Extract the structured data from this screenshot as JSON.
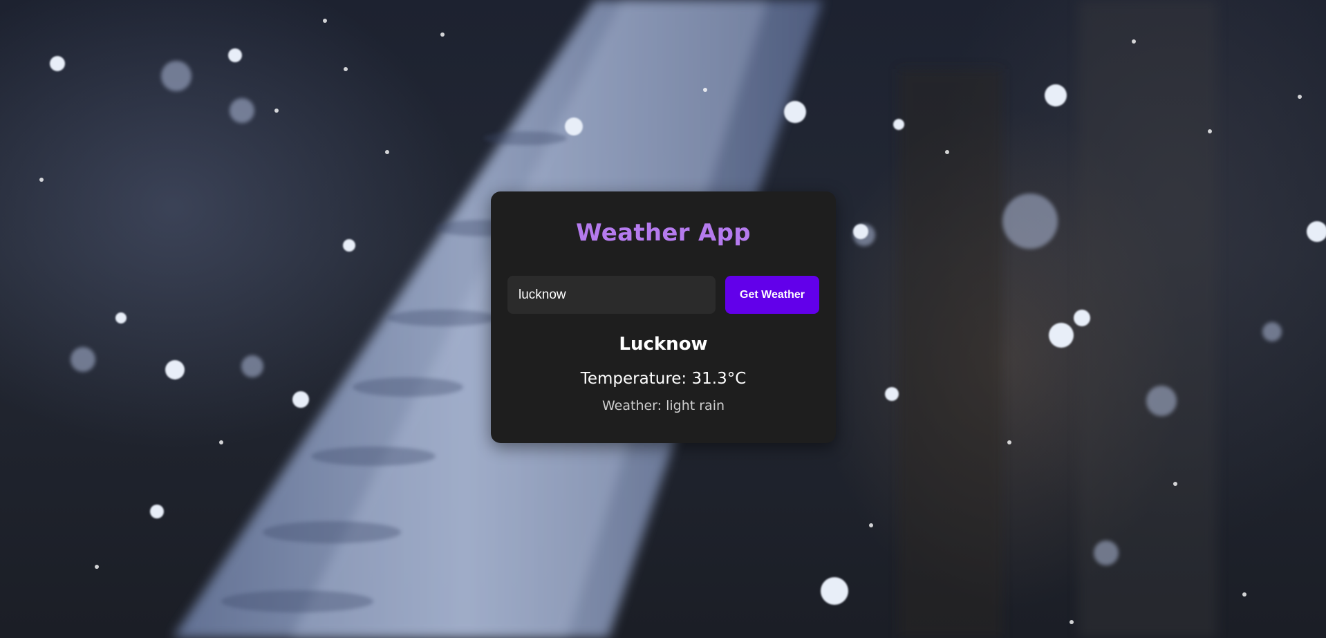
{
  "app": {
    "title": "Weather App"
  },
  "search": {
    "value": "lucknow",
    "button_label": "Get Weather"
  },
  "result": {
    "city": "Lucknow",
    "temperature": "Temperature: 31.3°C",
    "weather": "Weather: light rain"
  },
  "colors": {
    "accent": "#b57bee",
    "button": "#6200ea",
    "card": "#1e1e1e",
    "input": "#2b2b2b"
  }
}
